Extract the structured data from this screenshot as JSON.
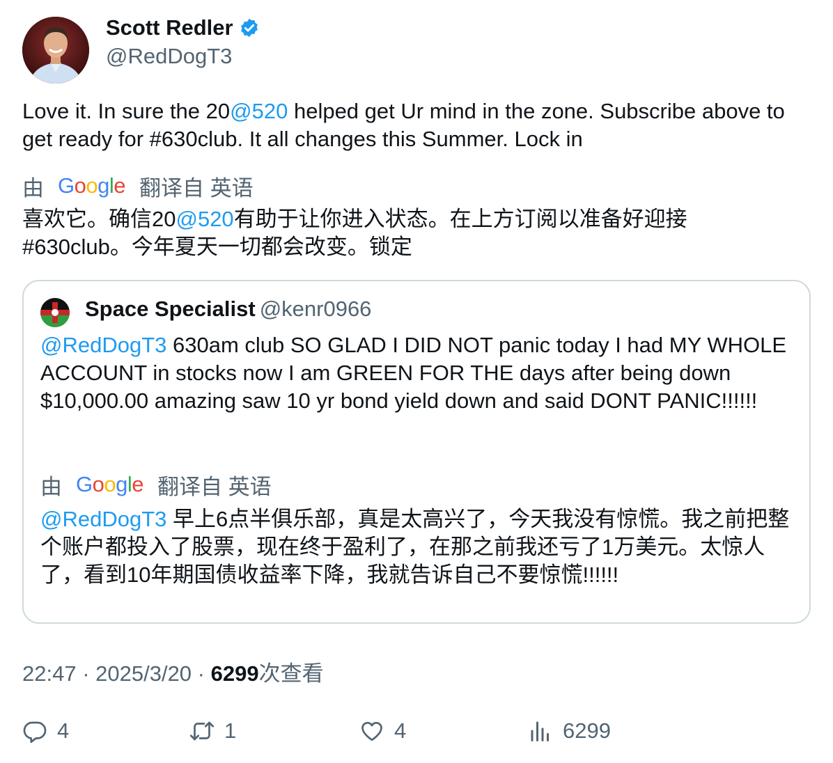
{
  "author": {
    "name": "Scott Redler",
    "handle": "@RedDogT3"
  },
  "tweet": {
    "text_1": "Love it. In sure the 20",
    "mention": "@520",
    "text_2": " helped get Ur mind in the zone.  Subscribe above to get ready for #630club. It all changes this Summer. Lock in"
  },
  "translation": {
    "by": "由",
    "google": {
      "G": "G",
      "o1": "o",
      "o2": "o",
      "g": "g",
      "l": "l",
      "e": "e"
    },
    "from": "翻译自 英语",
    "text_1": "喜欢它。确信20",
    "mention": "@520",
    "text_2": "有助于让你进入状态。在上方订阅以准备好迎接#630club。今年夏天一切都会改变。锁定"
  },
  "quote": {
    "name": "Space Specialist",
    "handle": "@kenr0966",
    "mention": "@RedDogT3",
    "text": " 630am club SO GLAD I DID NOT panic today   I had MY WHOLE ACCOUNT in stocks now I am GREEN FOR THE  days after being down $10,000.00 amazing saw 10 yr bond yield down and said DONT PANIC!!!!!!",
    "translation": {
      "by": "由",
      "from": "翻译自 英语",
      "mention": "@RedDogT3",
      "text": " 早上6点半俱乐部，真是太高兴了，今天我没有惊慌。我之前把整个账户都投入了股票，现在终于盈利了，在那之前我还亏了1万美元。太惊人了，看到10年期国债收益率下降，我就告诉自己不要惊慌!!!!!!"
    }
  },
  "meta": {
    "time": "22:47",
    "sep1": " · ",
    "date": "2025/3/20",
    "sep2": " · ",
    "views": "6299",
    "views_label": "次查看"
  },
  "actions": {
    "replies": "4",
    "reposts": "1",
    "likes": "4",
    "views": "6299"
  },
  "colors": {
    "link": "#1d9bf0",
    "secondary_text": "#536471",
    "primary_text": "#0f1419",
    "border": "#cfd9de"
  },
  "icons": [
    "verified-badge-icon",
    "reply-icon",
    "repost-icon",
    "like-icon",
    "views-icon"
  ]
}
